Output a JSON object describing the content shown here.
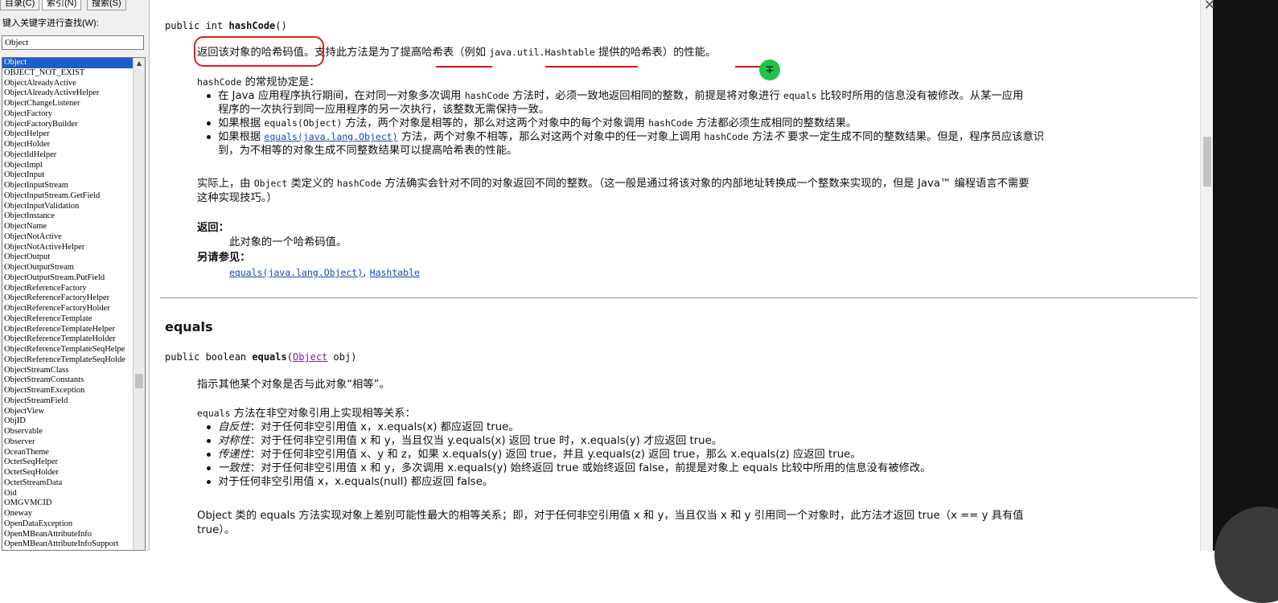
{
  "left_panel": {
    "tabs": [
      {
        "label": "目录(C)"
      },
      {
        "label": "索引(N)"
      },
      {
        "label": "搜索(S)"
      }
    ],
    "search_label": "键入关键字进行查找(W):",
    "search_value": "Object",
    "index_items": [
      "Object",
      "OBJECT_NOT_EXIST",
      "ObjectAlreadyActive",
      "ObjectAlreadyActiveHelper",
      "ObjectChangeListener",
      "ObjectFactory",
      "ObjectFactoryBuilder",
      "ObjectHelper",
      "ObjectHolder",
      "ObjectIdHelper",
      "ObjectImpl",
      "ObjectInput",
      "ObjectInputStream",
      "ObjectInputStream.GetField",
      "ObjectInputValidation",
      "ObjectInstance",
      "ObjectName",
      "ObjectNotActive",
      "ObjectNotActiveHelper",
      "ObjectOutput",
      "ObjectOutputStream",
      "ObjectOutputStream.PutField",
      "ObjectReferenceFactory",
      "ObjectReferenceFactoryHelper",
      "ObjectReferenceFactoryHolder",
      "ObjectReferenceTemplate",
      "ObjectReferenceTemplateHelper",
      "ObjectReferenceTemplateHolder",
      "ObjectReferenceTemplateSeqHelpe",
      "ObjectReferenceTemplateSeqHolde",
      "ObjectStreamClass",
      "ObjectStreamConstants",
      "ObjectStreamException",
      "ObjectStreamField",
      "ObjectView",
      "ObjID",
      "Observable",
      "Observer",
      "OceanTheme",
      "OctetSeqHelper",
      "OctetSeqHolder",
      "OctetStreamData",
      "Oid",
      "OMGVMCID",
      "Oneway",
      "OpenDataException",
      "OpenMBeanAttributeInfo",
      "OpenMBeanAttributeInfoSupport"
    ],
    "selected_index": 0
  },
  "hashcode": {
    "sig_prefix": "public int ",
    "sig_name": "hashCode",
    "sig_suffix": "()",
    "desc_1": "返回该对象的哈希码值",
    "desc_2": "。支持此方法是为了",
    "desc_3": "提高哈希表",
    "desc_4": "（例如 ",
    "desc_code": "java.util.Hashtable",
    "desc_5": " 提供的哈希表）的",
    "desc_6": "性能",
    "desc_7": "。",
    "contract_pre": "hashCode",
    "contract_post": " 的常规协定是：",
    "b1_l1_a": "在 Java 应用程序执行期间，在对同一对象多次调用 ",
    "b1_l1_code": "hashCode",
    "b1_l1_b": " 方法时，必须一致地返回相同的整数，前提是将对象进行 ",
    "b1_l1_code2": "equals",
    "b1_l1_c": " 比较时所用的信息没有被修改。从某一应用",
    "b1_l2": "程序的一次执行到同一应用程序的另一次执行，该整数无需保持一致。",
    "b2_a": "如果根据 ",
    "b2_code": "equals(Object)",
    "b2_b": " 方法，两个对象是相等的，那么对这两个对象中的每个对象调用 ",
    "b2_code2": "hashCode",
    "b2_c": " 方法都必须生成相同的整数结果。",
    "b3_l1_a": "如果根据 ",
    "b3_link": "equals(java.lang.Object)",
    "b3_l1_b": " 方法，两个对象不相等，那么对这两个对象中的任一对象上调用 ",
    "b3_code": "hashCode",
    "b3_l1_c": " 方法",
    "b3_em": "不",
    "b3_l1_d": " 要求一定生成不同的整数结果。但是，程序员应该意识",
    "b3_l2": "到，为不相等的对象生成不同整数结果可以提高哈希表的性能。",
    "p2_l1_a": "实际上，由 ",
    "p2_code": "Object",
    "p2_l1_b": " 类定义的 ",
    "p2_code2": "hashCode",
    "p2_l1_c": " 方法确实会针对不同的对象返回不同的整数。（这一般是通过将该对象的内部地址转换成一个整数来实现的，但是 Java™ 编程语言不需要",
    "p2_l2": "这种实现技巧。）",
    "returns_label": "返回：",
    "returns_value": "此对象的一个哈希码值。",
    "see_also_label": "另请参见：",
    "see_link_1": "equals(java.lang.Object)",
    "see_sep": ", ",
    "see_link_2": "Hashtable"
  },
  "equals": {
    "heading": "equals",
    "sig_prefix": "public boolean ",
    "sig_name": "equals",
    "sig_open": "(",
    "sig_param_type": "Object",
    "sig_rest": " obj)",
    "desc": "指示其他某个对象是否与此对象“相等”。",
    "intro_code": "equals",
    "intro_text": " 方法在非空对象引用上实现相等关系：",
    "items": [
      {
        "em": "自反性",
        "text": "：对于任何非空引用值 x，x.equals(x) 都应返回 true。"
      },
      {
        "em": "对称性",
        "text": "：对于任何非空引用值 x 和 y，当且仅当 y.equals(x) 返回 true 时，x.equals(y) 才应返回 true。"
      },
      {
        "em": "传递性",
        "text": "：对于任何非空引用值 x、y 和 z，如果 x.equals(y) 返回 true，并且 y.equals(z) 返回 true，那么 x.equals(z) 应返回 true。"
      },
      {
        "em": "一致性",
        "text": "：对于任何非空引用值 x 和 y，多次调用 x.equals(y) 始终返回 true 或始终返回 false，前提是对象上 equals 比较中所用的信息没有被修改。"
      },
      {
        "em": "",
        "text": "对于任何非空引用值 x，x.equals(null) 都应返回 false。"
      }
    ],
    "last_l1": "Object 类的 equals 方法实现对象上差别可能性最大的相等关系；即，对于任何非空引用值 x 和 y，当且仅当 x 和 y 引用同一个对象时，此方法才返回 true（x == y 具有值",
    "last_l2": "true）。"
  },
  "icons": {
    "cursor": "cursor-icon",
    "close": "close-icon"
  },
  "colors": {
    "annotation_red": "#e01f1f",
    "link_blue": "#1548b8",
    "selection_blue": "#1a5fcc",
    "cursor_green": "#22c24a"
  }
}
